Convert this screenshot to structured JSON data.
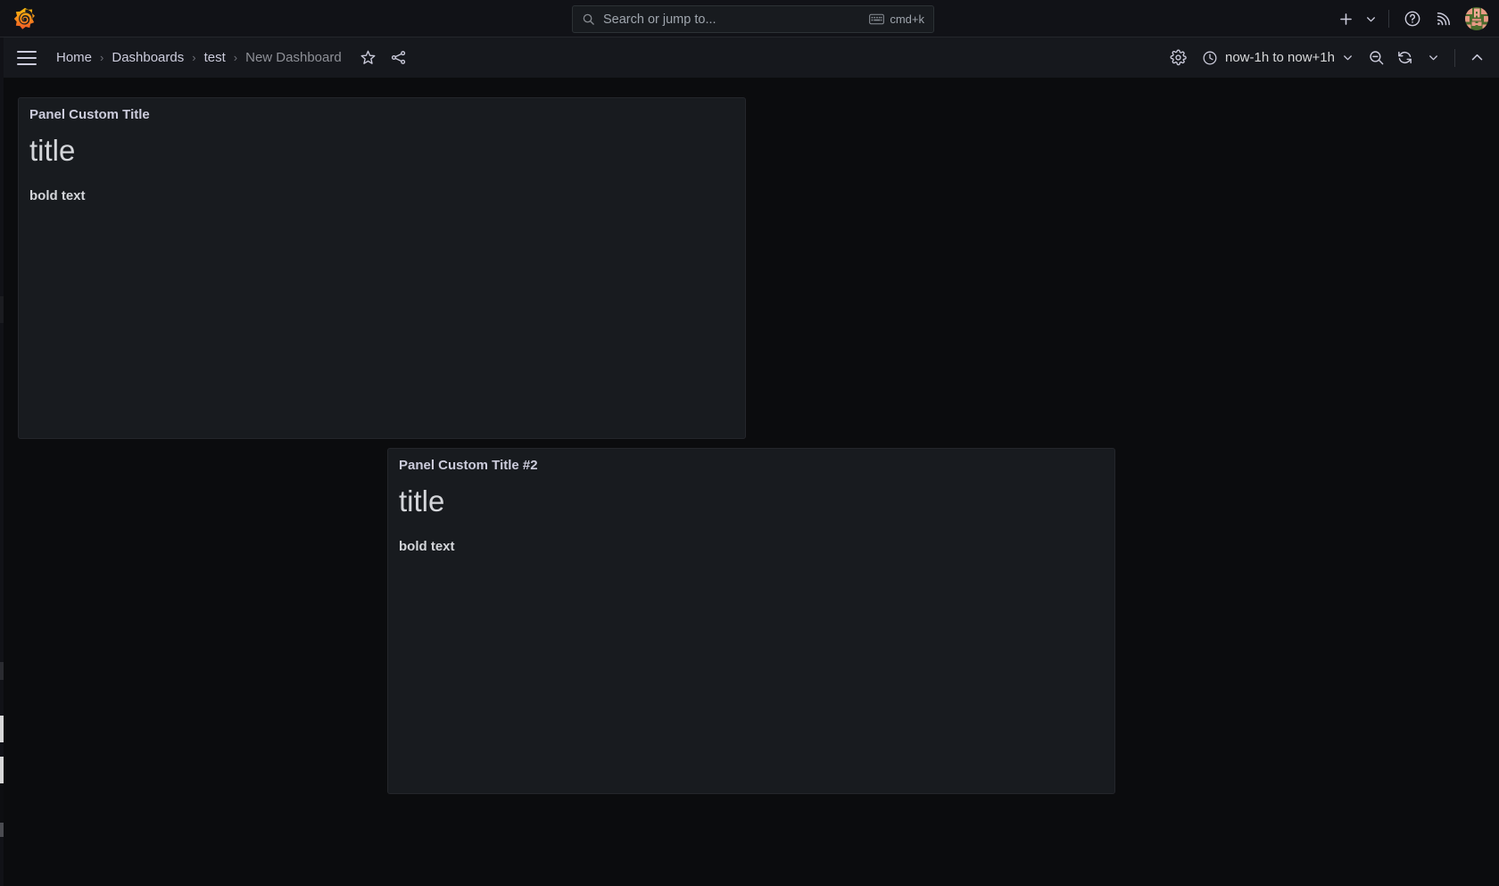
{
  "app": {
    "name": "Grafana",
    "logo_icon": "grafana-logo-icon",
    "accent_orange": "#f05a28",
    "accent_yellow": "#fbbc0a",
    "bg_canvas": "#0b0c0e",
    "bg_panel": "#181b1f",
    "bg_topnav": "#111217",
    "bg_toolbar": "#16181d",
    "text_primary": "#ccccdc",
    "text_secondary": "#9fa5ad"
  },
  "topnav": {
    "search": {
      "icon": "search-icon",
      "placeholder": "Search or jump to...",
      "value": "",
      "shortcut_label": "cmd+k",
      "shortcut_icon": "keyboard-icon"
    },
    "actions": [
      {
        "name": "new-button",
        "icon": "plus-icon",
        "label": ""
      },
      {
        "name": "new-dropdown",
        "icon": "chevron-down-icon",
        "label": ""
      },
      {
        "name": "help-button",
        "icon": "question-circle-icon",
        "label": ""
      },
      {
        "name": "news-button",
        "icon": "rss-feed-icon",
        "label": ""
      },
      {
        "name": "profile-avatar",
        "icon": "avatar-icon",
        "label": ""
      }
    ]
  },
  "toolbar": {
    "menu_icon": "hamburger-menu-icon",
    "breadcrumb": [
      {
        "label": "Home",
        "current": false
      },
      {
        "label": "Dashboards",
        "current": false
      },
      {
        "label": "test",
        "current": false
      },
      {
        "label": "New Dashboard",
        "current": true
      }
    ],
    "breadcrumb_separator": "›",
    "breadcrumb_actions": [
      {
        "name": "favorite-star-button",
        "icon": "star-outline-icon"
      },
      {
        "name": "share-button",
        "icon": "share-nodes-icon"
      }
    ],
    "right_controls": {
      "settings": {
        "name": "dashboard-settings-button",
        "icon": "gear-icon"
      },
      "time_range": {
        "name": "time-range-picker",
        "icon": "clock-icon",
        "label": "now-1h to now+1h",
        "chevron": "chevron-down-icon"
      },
      "zoom_out": {
        "name": "zoom-out-time-button",
        "icon": "magnifier-minus-icon"
      },
      "refresh": {
        "name": "refresh-dashboard-button",
        "icon": "refresh-icon"
      },
      "refresh_interval": {
        "name": "refresh-interval-dropdown",
        "icon": "chevron-down-icon"
      },
      "collapse": {
        "name": "collapse-toolbar-button",
        "icon": "chevron-up-icon"
      }
    }
  },
  "dashboard": {
    "panels": [
      {
        "title": "Panel Custom Title",
        "heading": "title",
        "bold_text": "bold text"
      },
      {
        "title": "Panel Custom Title #2",
        "heading": "title",
        "bold_text": "bold text"
      }
    ]
  }
}
